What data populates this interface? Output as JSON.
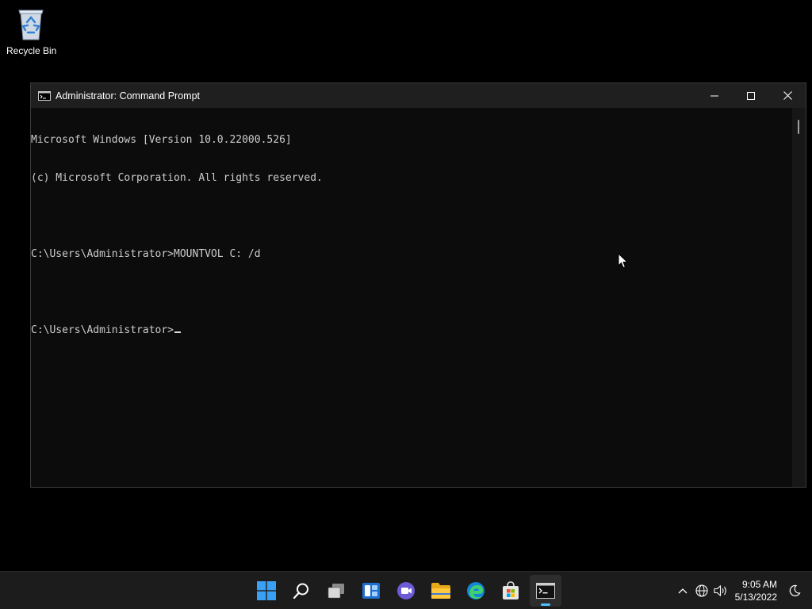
{
  "desktop": {
    "recycle_bin_label": "Recycle Bin"
  },
  "window": {
    "title": "Administrator: Command Prompt",
    "console_lines": [
      "Microsoft Windows [Version 10.0.22000.526]",
      "(c) Microsoft Corporation. All rights reserved.",
      "",
      "C:\\Users\\Administrator>MOUNTVOL C: /d",
      "",
      "C:\\Users\\Administrator>"
    ]
  },
  "taskbar": {
    "apps": [
      "start-icon",
      "search-icon",
      "task-view-icon",
      "widgets-icon",
      "chat-icon",
      "file-explorer-icon",
      "edge-icon",
      "store-icon",
      "command-prompt-icon"
    ],
    "active_app": "command-prompt-icon",
    "accent_color": "#4cc2ff"
  },
  "tray": {
    "time": "9:05 AM",
    "date": "5/13/2022"
  }
}
